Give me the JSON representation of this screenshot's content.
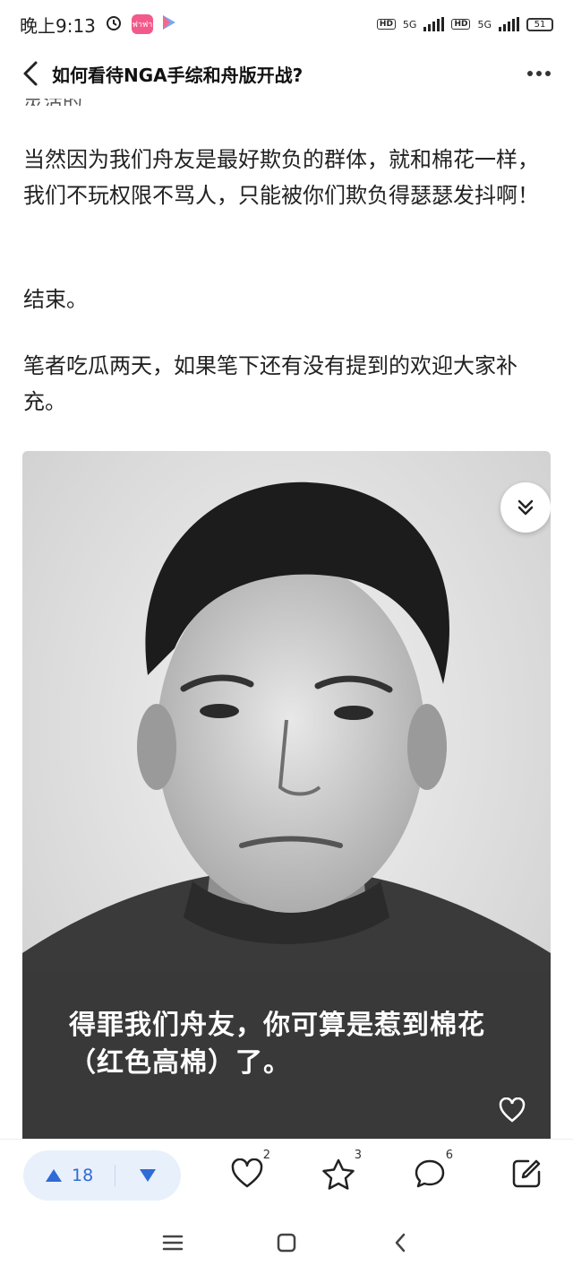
{
  "status_bar": {
    "time": "晚上9:13",
    "app_badge": "ฟาฟา",
    "hd_left": "HD",
    "network_left": "5G",
    "hd_right": "HD",
    "network_right": "5G",
    "battery": "51"
  },
  "header": {
    "title": "如何看待NGA手综和舟版开战?",
    "back_icon": "chevron-left-icon",
    "more_icon": "more-dots-icon"
  },
  "article": {
    "cut_off_text": "灵活的",
    "paragraphs": [
      "当然因为我们舟友是最好欺负的群体，就和棉花一样，我们不玩权限不骂人，只能被你们欺负得瑟瑟发抖啊！",
      "结束。",
      "笔者吃瓜两天，如果笔下还有没有提到的欢迎大家补充。"
    ],
    "image_caption": "得罪我们舟友，你可算是惹到棉花（红色高棉）了。"
  },
  "actions": {
    "upvote_count": "18",
    "like_count": "2",
    "favorite_count": "3",
    "comment_count": "6"
  },
  "colors": {
    "accent": "#2f6bd6",
    "vote_bg": "#e8f0fb"
  }
}
